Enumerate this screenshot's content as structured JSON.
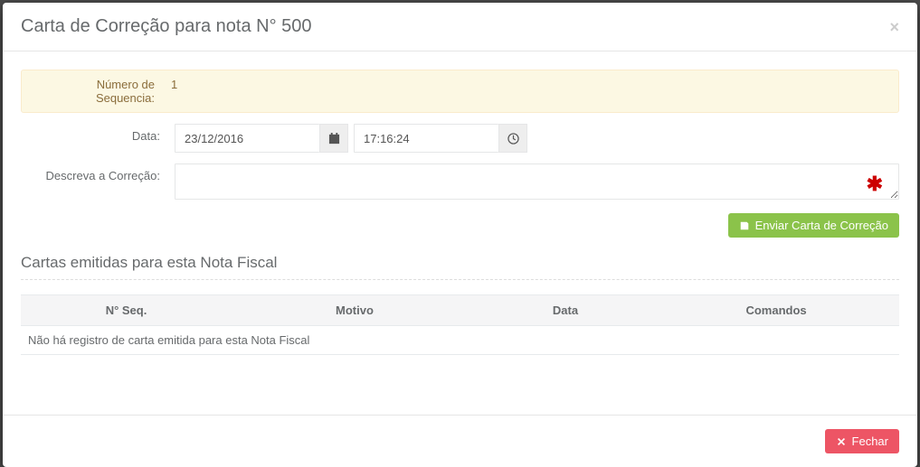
{
  "modal": {
    "title": "Carta de Correção para nota N° 500",
    "close_label": "×"
  },
  "alert": {
    "label": "Número de Sequencia:",
    "value": "1"
  },
  "form": {
    "date_label": "Data:",
    "date_value": "23/12/2016",
    "time_value": "17:16:24",
    "desc_label": "Descreva a Correção:",
    "desc_value": ""
  },
  "buttons": {
    "send": "Enviar Carta de Correção",
    "close": "Fechar"
  },
  "section": {
    "heading": "Cartas emitidas para esta Nota Fiscal"
  },
  "table": {
    "headers": {
      "seq": "N° Seq.",
      "motivo": "Motivo",
      "data": "Data",
      "comandos": "Comandos"
    },
    "empty_message": "Não há registro de carta emitida para esta Nota Fiscal"
  }
}
